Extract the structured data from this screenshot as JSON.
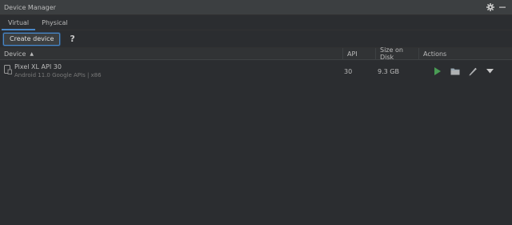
{
  "window": {
    "title": "Device Manager"
  },
  "tabs": [
    {
      "label": "Virtual",
      "active": true
    },
    {
      "label": "Physical",
      "active": false
    }
  ],
  "toolbar": {
    "create_label": "Create device",
    "help_label": "?"
  },
  "table": {
    "columns": [
      "Device",
      "API",
      "Size on Disk",
      "Actions"
    ],
    "sort_indicator": "▲",
    "rows": [
      {
        "name": "Pixel XL API 30",
        "subtitle": "Android 11.0 Google APIs | x86",
        "api": "30",
        "size": "9.3 GB",
        "actions": [
          "play-icon",
          "folder-icon",
          "pencil-icon",
          "chevron-down-icon"
        ]
      }
    ]
  },
  "colors": {
    "background": "#2b2d30",
    "accent": "#4a88c7",
    "run": "#499c54"
  }
}
